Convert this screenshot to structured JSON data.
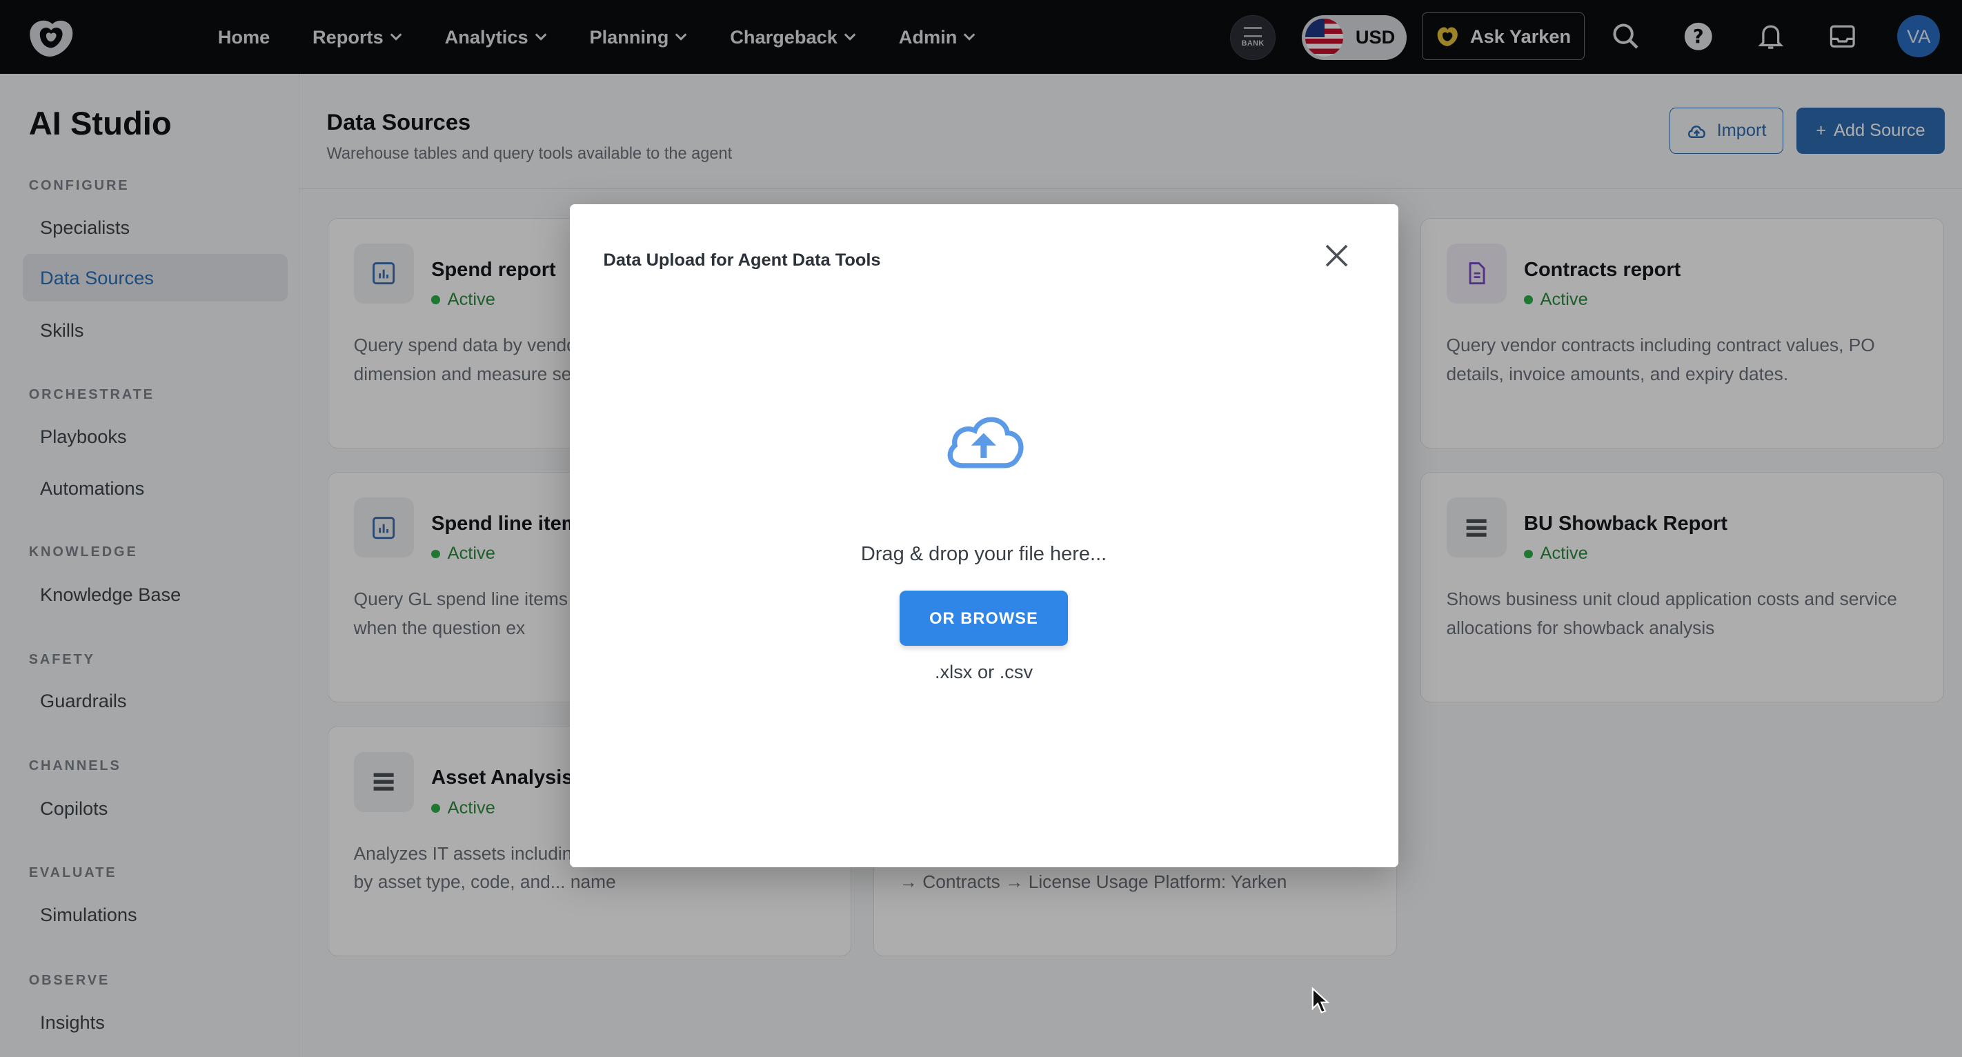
{
  "nav": {
    "items": [
      "Home",
      "Reports",
      "Analytics",
      "Planning",
      "Chargeback",
      "Admin"
    ],
    "bank_label": "BANK",
    "currency": "USD",
    "ask_label": "Ask Yarken",
    "avatar_initials": "VA"
  },
  "sidebar": {
    "title": "AI Studio",
    "sections": [
      {
        "label": "CONFIGURE",
        "items": [
          "Specialists",
          "Data Sources",
          "Skills"
        ]
      },
      {
        "label": "ORCHESTRATE",
        "items": [
          "Playbooks",
          "Automations"
        ]
      },
      {
        "label": "KNOWLEDGE",
        "items": [
          "Knowledge Base"
        ]
      },
      {
        "label": "SAFETY",
        "items": [
          "Guardrails"
        ]
      },
      {
        "label": "CHANNELS",
        "items": [
          "Copilots"
        ]
      },
      {
        "label": "EVALUATE",
        "items": [
          "Simulations"
        ]
      },
      {
        "label": "OBSERVE",
        "items": [
          "Insights"
        ]
      }
    ],
    "active_item": "Data Sources"
  },
  "header": {
    "title": "Data Sources",
    "subtitle": "Warehouse tables and query tools available to the agent",
    "import_label": "Import",
    "add_label": "Add Source"
  },
  "cards": [
    {
      "title": "Spend report",
      "status": "Active",
      "icon": "chart-icon",
      "desc": "Query spend data by vendor, period and organisational dimension and measure se"
    },
    {
      "title": "Contracts report",
      "status": "Active",
      "icon": "document-icon",
      "desc": "Query vendor contracts including contract values, PO details, invoice amounts, and expiry dates."
    },
    {
      "title": "Spend line items",
      "status": "Active",
      "icon": "chart-icon",
      "desc": "Query GL spend line items journal lines, invoice numb only when the question ex"
    },
    {
      "title": "BU Showback Report",
      "status": "Active",
      "icon": "list-icon",
      "desc": "Shows business unit cloud application costs and service allocations for showback analysis"
    },
    {
      "title": "Asset Analysis",
      "status": "Active",
      "icon": "list-icon",
      "desc": "Analyzes IT assets including hardware, and related costs by asset type, code, and... name"
    },
    {
      "title": "",
      "status": "",
      "icon": "",
      "desc": "Agent Type: Analytical Reporting Agent Module: Repor... → Contracts → License Usage Platform: Yarken"
    }
  ],
  "modal": {
    "title": "Data Upload for Agent Data Tools",
    "drop_text": "Drag & drop your file here...",
    "browse_label": "OR BROWSE",
    "extensions": ".xlsx or .csv"
  },
  "colors": {
    "accent": "#2f6cb3",
    "browse": "#2f86e6",
    "active_status": "#2fb14a",
    "topbar": "#0b0d10"
  }
}
